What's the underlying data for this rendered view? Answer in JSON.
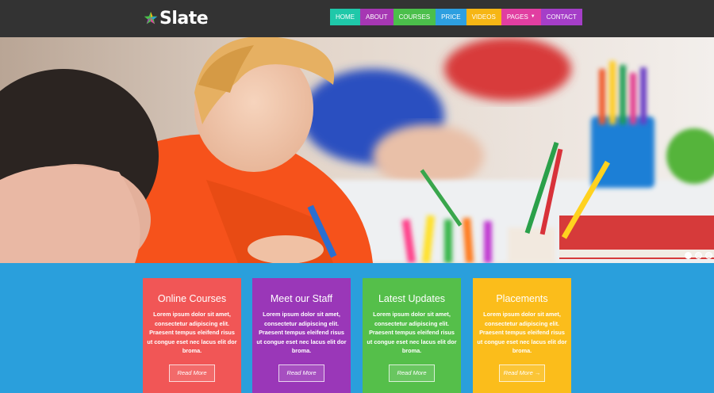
{
  "brand": {
    "name": "Slate",
    "logo_icon": "star-icon"
  },
  "nav": [
    {
      "label": "HOME",
      "color": "#1fc8a9"
    },
    {
      "label": "ABOUT",
      "color": "#a637b3"
    },
    {
      "label": "COURSES",
      "color": "#4bbf4b"
    },
    {
      "label": "PRICE",
      "color": "#2d9fe0"
    },
    {
      "label": "VIDEOS",
      "color": "#f6b615"
    },
    {
      "label": "PAGES",
      "color": "#e13ea1",
      "has_dropdown": true,
      "dropdown_icon": "caret-down-icon"
    },
    {
      "label": "CONTACT",
      "color": "#a53ec8"
    }
  ],
  "slider": {
    "slides": 3,
    "active_slide": 1
  },
  "features": [
    {
      "title": "Online Courses",
      "text": "Lorem ipsum dolor sit amet, consectetur adipiscing elit. Praesent tempus eleifend risus ut congue eset nec lacus elit dor broma.",
      "button": "Read More",
      "color": "#f15656"
    },
    {
      "title": "Meet our Staff",
      "text": "Lorem ipsum dolor sit amet, consectetur adipiscing elit. Praesent tempus eleifend risus ut congue eset nec lacus elit dor broma.",
      "button": "Read More",
      "color": "#9a37b8"
    },
    {
      "title": "Latest Updates",
      "text": "Lorem ipsum dolor sit amet, consectetur adipiscing elit. Praesent tempus eleifend risus ut congue eset nec lacus elit dor broma.",
      "button": "Read More",
      "color": "#55bf4a"
    },
    {
      "title": "Placements",
      "text": "Lorem ipsum dolor sit amet, consectetur adipiscing elit. Praesent tempus eleifend risus ut congue eset nec lacus elit dor broma.",
      "button": "Read More →",
      "color": "#fbbd1b"
    }
  ],
  "colors": {
    "header_bg": "#333333",
    "section_bg": "#2a9fdc"
  }
}
